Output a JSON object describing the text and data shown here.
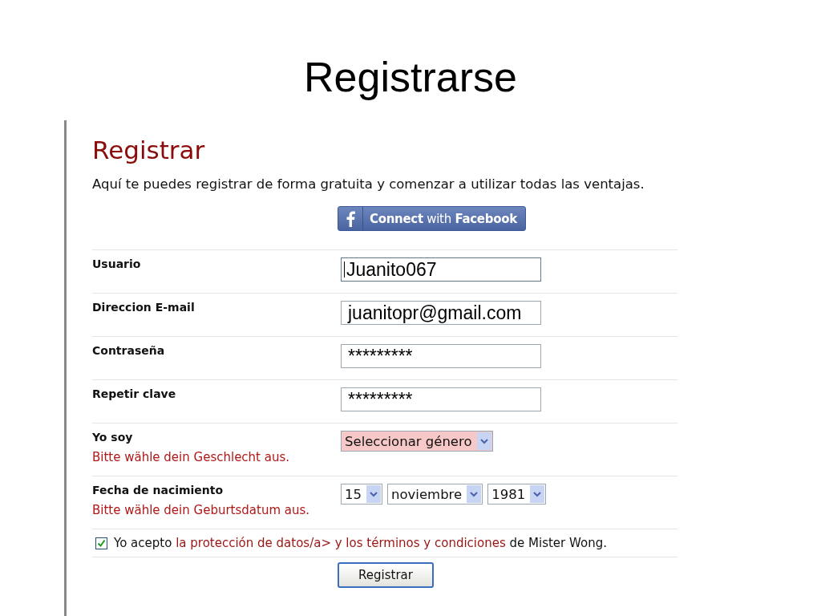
{
  "slide_title": "Registrarse",
  "heading": "Registrar",
  "intro": "Aquí te puedes registrar de forma gratuita y comenzar a utilizar todas las ventajas.",
  "facebook_button": {
    "label_bold": "Connect",
    "label_plain": "with",
    "label_brand": "Facebook"
  },
  "fields": [
    {
      "kind": "text",
      "label": "Usuario",
      "value": "Juanito067",
      "focused": true
    },
    {
      "kind": "text",
      "label": "Direccion E-mail",
      "value": "juanitopr@gmail.com",
      "focused": false
    },
    {
      "kind": "text",
      "label": "Contraseña",
      "value": "*********",
      "focused": false
    },
    {
      "kind": "text",
      "label": "Repetir clave",
      "value": "*********",
      "focused": false
    },
    {
      "kind": "select",
      "label": "Yo soy",
      "error": "Bitte wähle dein Geschlecht aus.",
      "selects": [
        {
          "value": "Seleccionar género",
          "invalid": true
        }
      ]
    },
    {
      "kind": "select",
      "label": "Fecha de nacimiento",
      "error": "Bitte wähle dein Geburtsdatum aus.",
      "selects": [
        {
          "value": "15",
          "invalid": false
        },
        {
          "value": "noviembre",
          "invalid": false
        },
        {
          "value": "1981",
          "invalid": false
        }
      ]
    }
  ],
  "agreement": {
    "checked": true,
    "prefix": "Yo acepto",
    "link": "la protección de datos/a> y los términos y condiciones",
    "suffix": "de Mister Wong."
  },
  "submit_button": "Registrar"
}
